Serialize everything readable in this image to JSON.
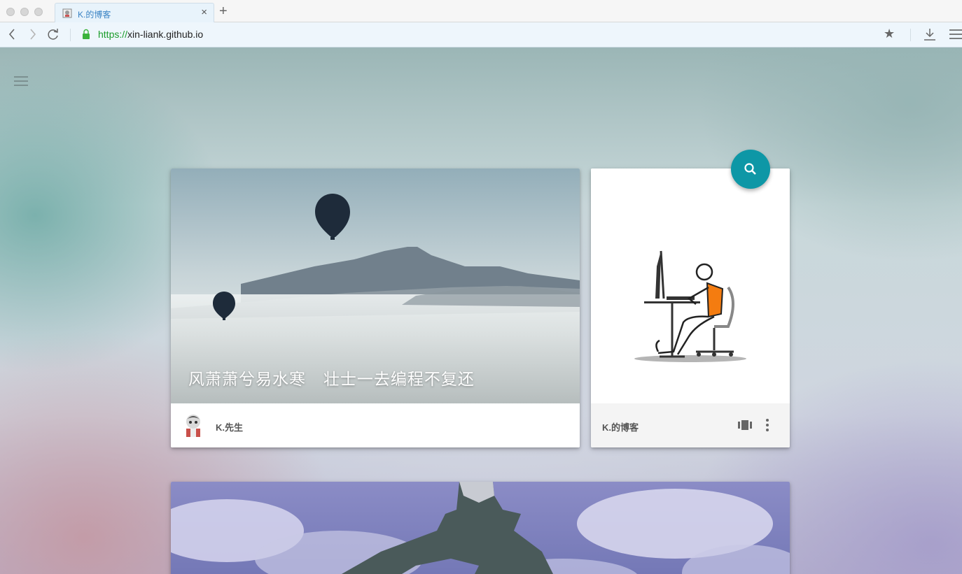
{
  "browser": {
    "tab_title": "K.的博客",
    "tab_close": "×",
    "new_tab": "+",
    "url_scheme": "https://",
    "url_host": "xin-liank.github.io",
    "icons": [
      "back-icon",
      "forward-icon",
      "reload-icon",
      "lock-icon",
      "star-icon",
      "download-icon",
      "menu-icon"
    ]
  },
  "page": {
    "featured_post": {
      "title": "风萧萧兮易水寒   壮士一去编程不复还",
      "author": "K.先生"
    },
    "side_card": {
      "blog_name": "K.的博客"
    },
    "colors": {
      "accent": "#0e97a6",
      "secure_green": "#1a9c2a",
      "tab_link": "#3a83c4"
    }
  }
}
